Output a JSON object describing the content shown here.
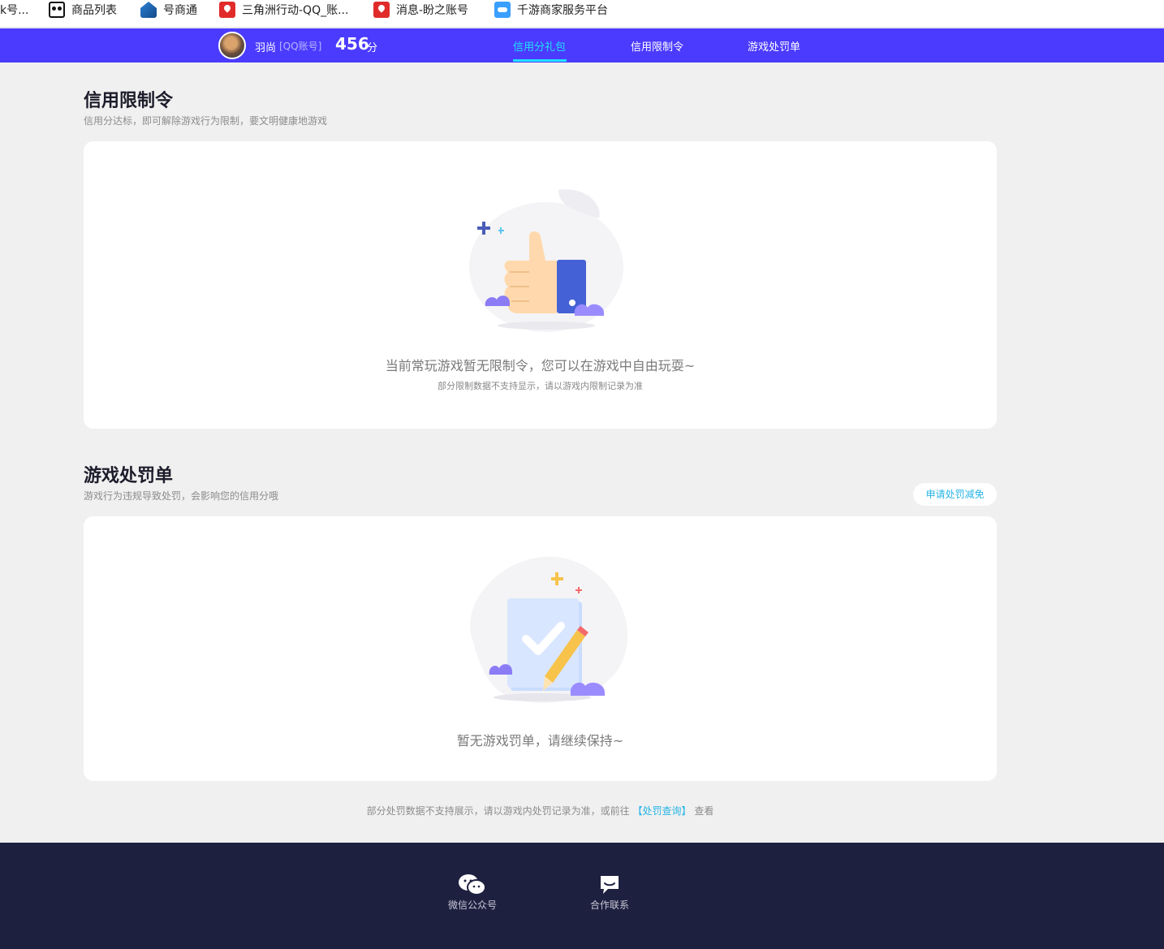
{
  "bookmarks": [
    {
      "label": "k号...",
      "icon": "truncated"
    },
    {
      "label": "商品列表",
      "icon": "panda-icon"
    },
    {
      "label": "号商通",
      "icon": "house-icon"
    },
    {
      "label": "三角洲行动-QQ_账...",
      "icon": "red-pin-icon"
    },
    {
      "label": "消息-盼之账号",
      "icon": "red-pin-icon"
    },
    {
      "label": "千游商家服务平台",
      "icon": "gamepad-icon"
    }
  ],
  "header": {
    "username": "羽尚",
    "account_type": "[QQ账号]",
    "score": "456",
    "score_unit": "分",
    "tabs": [
      {
        "label": "信用分礼包",
        "active": true
      },
      {
        "label": "信用限制令",
        "active": false
      },
      {
        "label": "游戏处罚单",
        "active": false
      }
    ]
  },
  "restriction": {
    "title": "信用限制令",
    "subtitle": "信用分达标，即可解除游戏行为限制，要文明健康地游戏",
    "empty_message": "当前常玩游戏暂无限制令，您可以在游戏中自由玩耍~",
    "note": "部分限制数据不支持显示，请以游戏内限制记录为准"
  },
  "penalty": {
    "title": "游戏处罚单",
    "subtitle": "游戏行为违规导致处罚，会影响您的信用分哦",
    "apply_button": "申请处罚减免",
    "empty_message": "暂无游戏罚单，请继续保持~"
  },
  "footnote": {
    "text": "部分处罚数据不支持展示，请以游戏内处罚记录为准，或前往",
    "link": "【处罚查询】",
    "suffix": "查看"
  },
  "footer": {
    "items": [
      {
        "label": "微信公众号",
        "icon": "wechat-icon"
      },
      {
        "label": "合作联系",
        "icon": "chat-icon"
      }
    ]
  },
  "colors": {
    "nav_bg": "#4b3bff",
    "nav_active": "#20e0ff",
    "footer_bg": "#1e2040",
    "link": "#27b5e6"
  }
}
